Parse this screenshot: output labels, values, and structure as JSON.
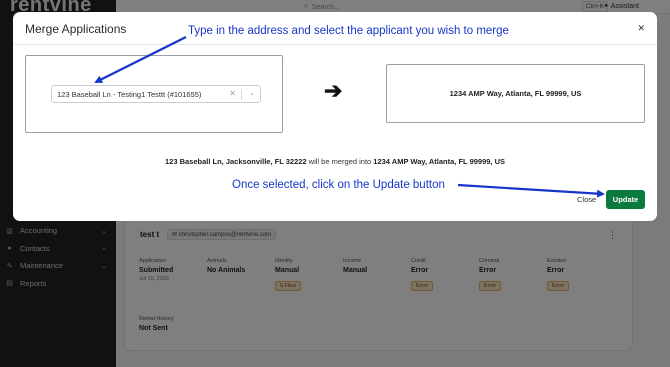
{
  "app": {
    "logo": "rentvine",
    "search_placeholder": "Search...",
    "search_shortcut": "Ctrl+K",
    "assistant_label": "Assistant",
    "nav": [
      {
        "label": "Accounting",
        "icon": "bank-icon"
      },
      {
        "label": "Contacts",
        "icon": "users-icon"
      },
      {
        "label": "Maintenance",
        "icon": "wrench-icon"
      },
      {
        "label": "Reports",
        "icon": "chart-icon"
      }
    ]
  },
  "applicant": {
    "name": "test t",
    "email": "christopher.campos@rentvine.com",
    "columns": [
      {
        "label": "Application",
        "value": "Submitted",
        "sub": "Jul 15, 2026"
      },
      {
        "label": "Animals",
        "value": "No Animals"
      },
      {
        "label": "Identity",
        "value": "Manual",
        "pill": "0 Files"
      },
      {
        "label": "Income",
        "value": "Manual"
      },
      {
        "label": "Credit",
        "value": "Error",
        "pill": "Error"
      },
      {
        "label": "Criminal",
        "value": "Error",
        "pill": "Error"
      },
      {
        "label": "Eviction",
        "value": "Error",
        "pill": "Error"
      }
    ],
    "rental_history_label": "Rental History",
    "rental_history_value": "Not Sent"
  },
  "modal": {
    "title": "Merge Applications",
    "select_value": "123 Baseball Ln - Testing1 Testtt (#101655)",
    "target_address": "1234 AMP Way, Atlanta, FL 99999, US",
    "merge_source": "123 Baseball Ln, Jacksonville, FL 32222",
    "merge_middle": " will be merged into ",
    "merge_target": "1234 AMP Way, Atlanta, FL 99999, US",
    "close_label": "Close",
    "update_label": "Update"
  },
  "annotations": {
    "top": "Type in the address and select the applicant you wish to merge",
    "bottom": "Once selected, click on the Update button",
    "color": "#1736c9"
  },
  "colors": {
    "primary_button": "#0a7a3e",
    "sidebar": "#1f2326"
  }
}
